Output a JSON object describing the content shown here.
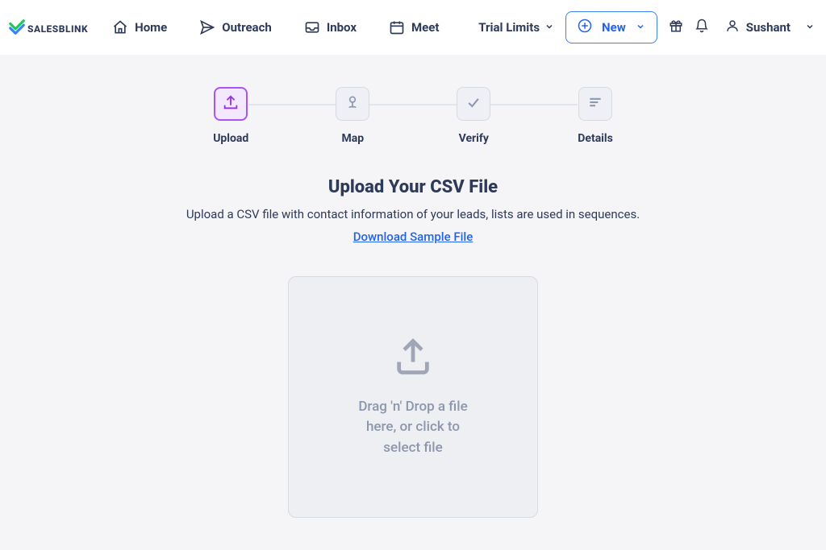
{
  "logo": {
    "brand_first": "SALES",
    "brand_second": "BLINK"
  },
  "nav": {
    "home": "Home",
    "outreach": "Outreach",
    "inbox": "Inbox",
    "meet": "Meet"
  },
  "header": {
    "trial_limits": "Trial Limits",
    "new_button": "New",
    "user_name": "Sushant"
  },
  "steps": {
    "upload": "Upload",
    "map": "Map",
    "verify": "Verify",
    "details": "Details"
  },
  "main": {
    "title": "Upload Your CSV File",
    "subtitle": "Upload a CSV file with contact information of your leads, lists are used in sequences.",
    "sample_link": "Download Sample File",
    "dropzone_text": "Drag 'n' Drop a file here, or click to select file"
  }
}
